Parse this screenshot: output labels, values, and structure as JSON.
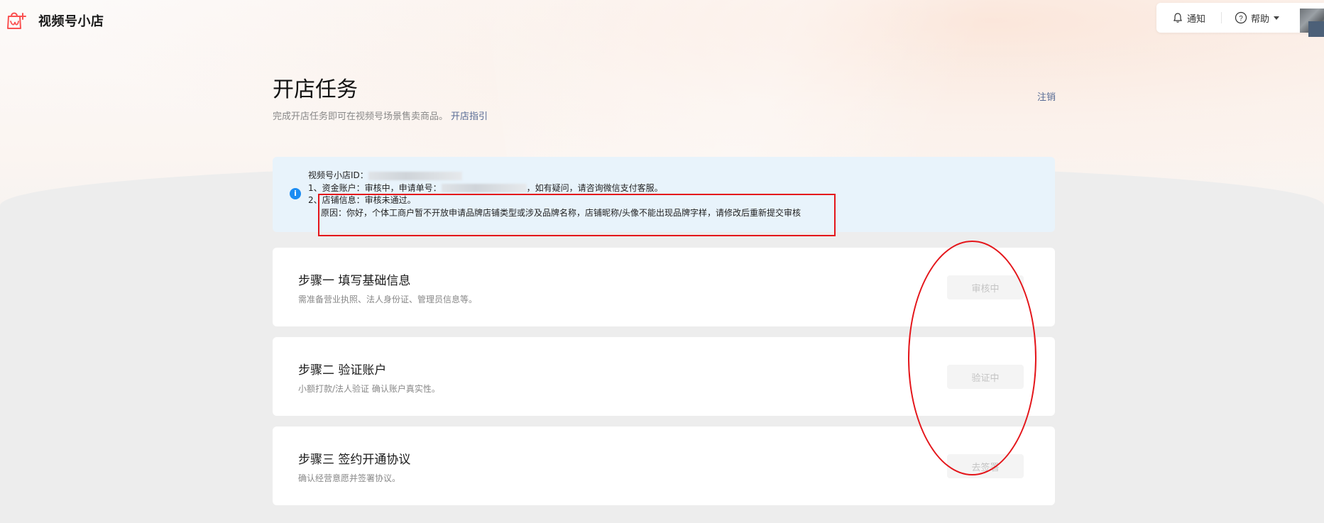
{
  "app": {
    "name": "视频号小店",
    "brand_icon": "shop-bag-icon",
    "accent_color": "#fa5151"
  },
  "topbar": {
    "notify_label": "通知",
    "notify_icon": "bell-icon",
    "help_label": "帮助",
    "help_icon": "question-circle-icon"
  },
  "page": {
    "title": "开店任务",
    "subtitle": "完成开店任务即可在视频号场景售卖商品。",
    "guide_link": "开店指引",
    "cancel_link": "注销"
  },
  "notice": {
    "icon": "info-icon",
    "shop_id_label": "视频号小店ID：",
    "line1_prefix": "1、资金账户：审核中，申请单号：",
    "line1_suffix": "，如有疑问，请咨询微信支付客服。",
    "line2": "2、店铺信息：审核未通过。",
    "reason": "原因：你好，个体工商户暂不开放申请品牌店铺类型或涉及品牌名称，店铺昵称/头像不能出现品牌字样，请修改后重新提交审核"
  },
  "steps": [
    {
      "title": "步骤一 填写基础信息",
      "desc": "需准备营业执照、法人身份证、管理员信息等。",
      "button": "审核中"
    },
    {
      "title": "步骤二 验证账户",
      "desc": "小额打款/法人验证 确认账户真实性。",
      "button": "验证中"
    },
    {
      "title": "步骤三 签约开通协议",
      "desc": "确认经营意愿并签署协议。",
      "button": "去签署"
    }
  ],
  "annotation_color": "#e4151a"
}
